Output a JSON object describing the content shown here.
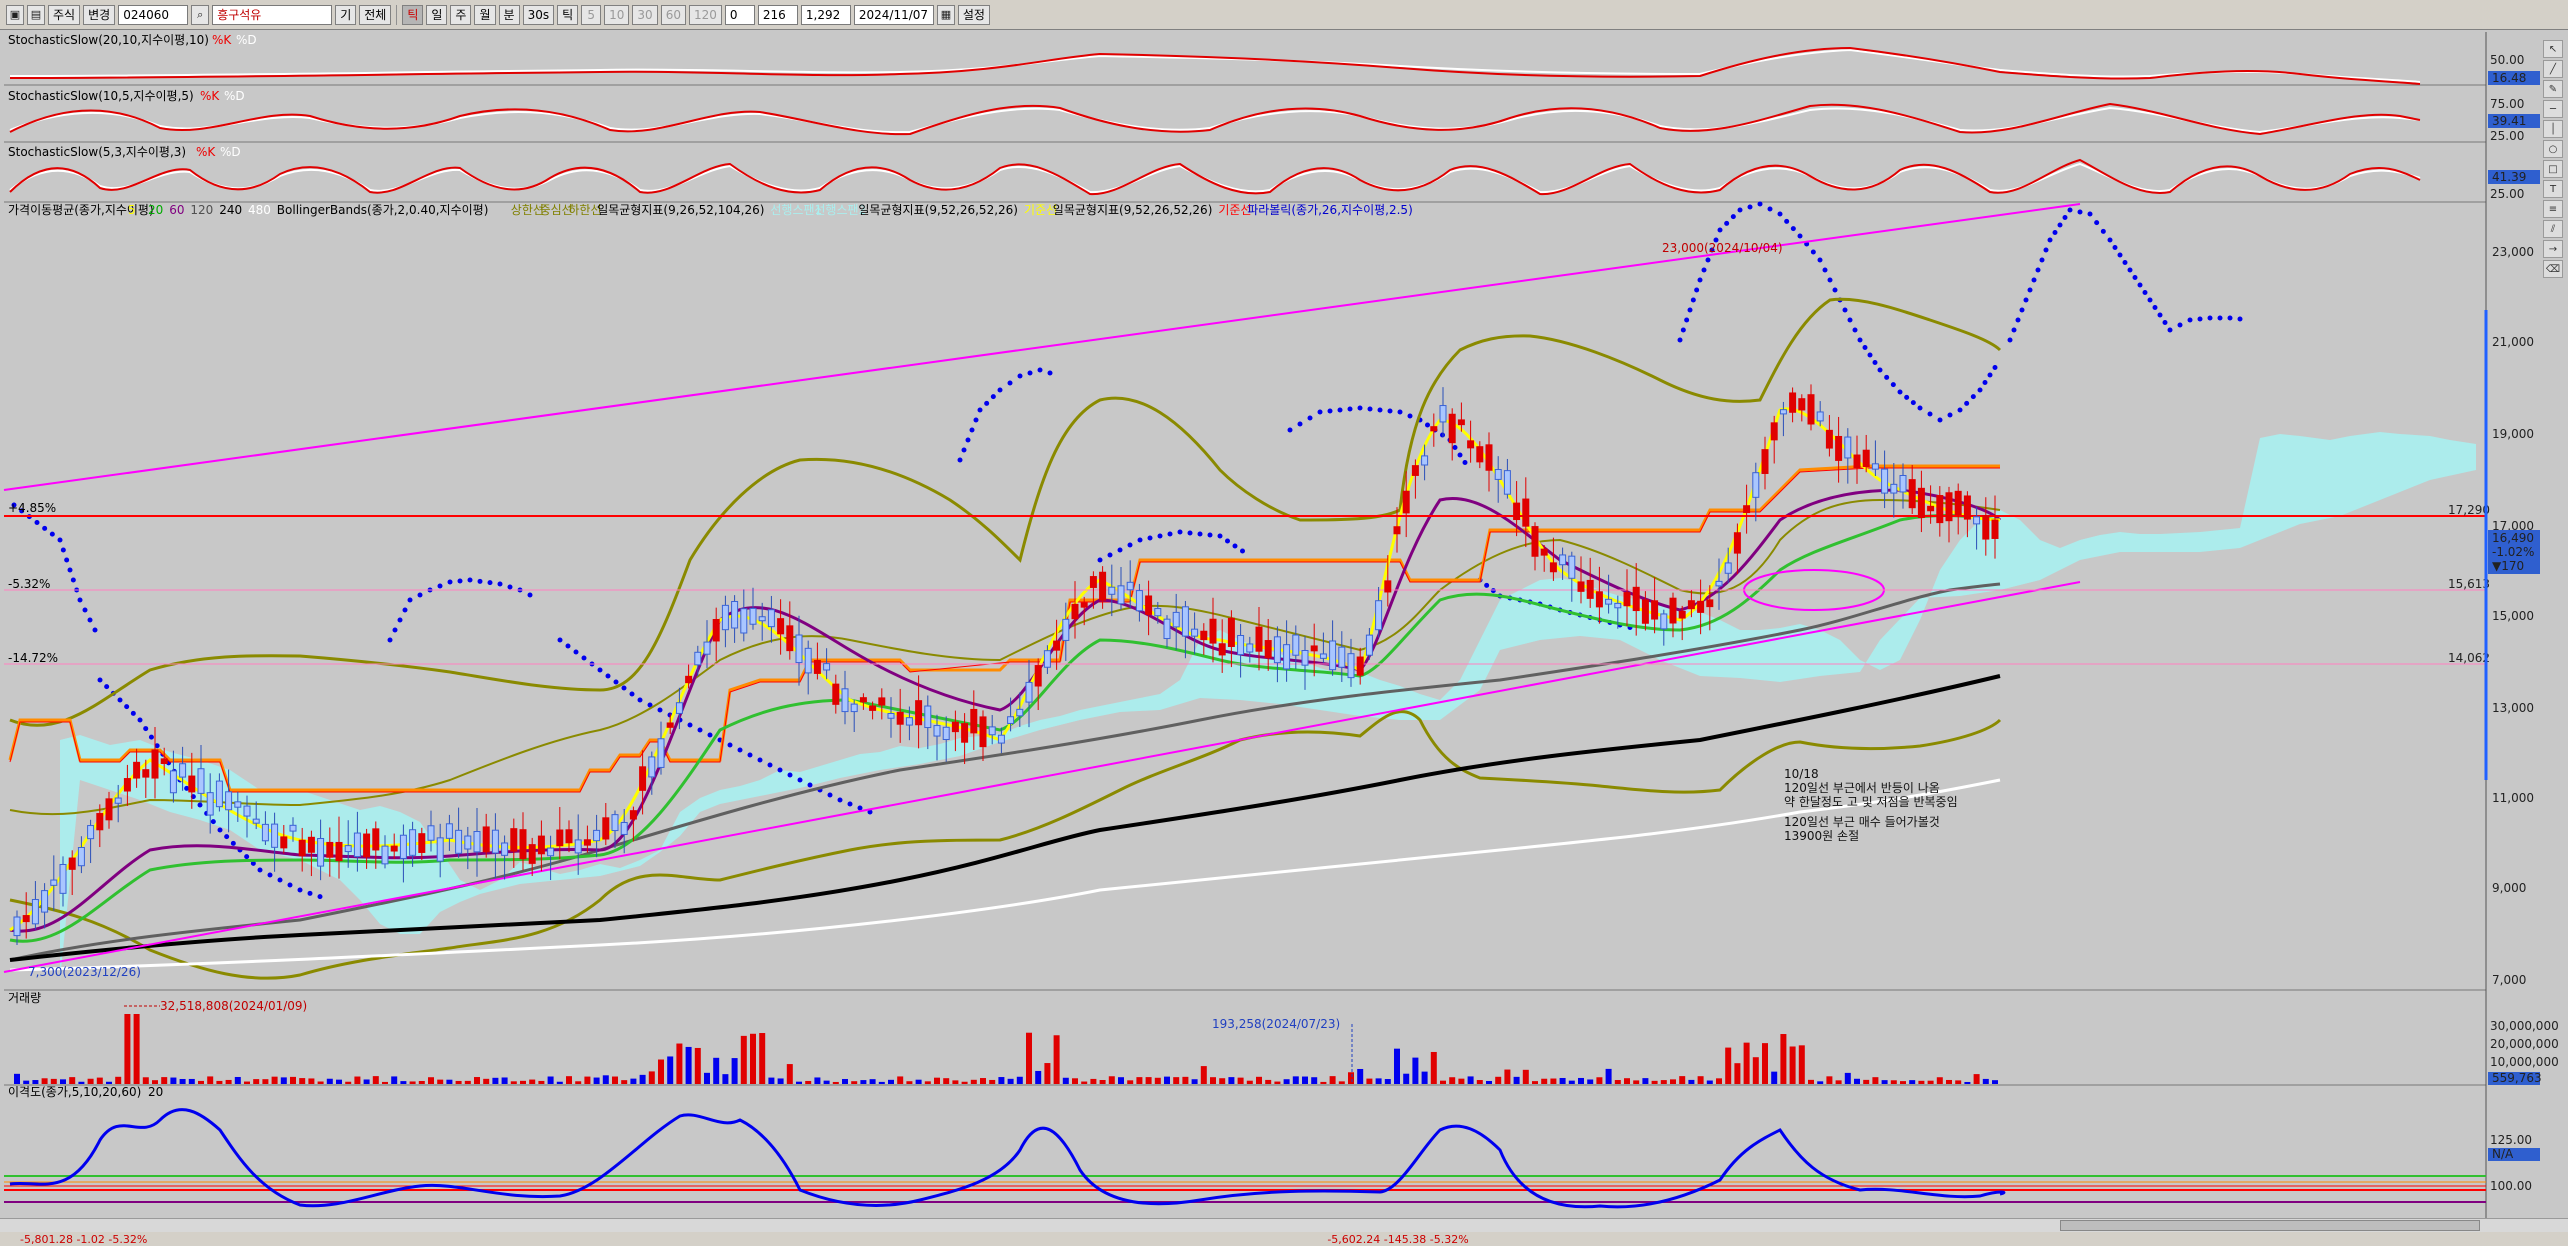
{
  "toolbar": {
    "market": "주식",
    "mode": "변경",
    "code": "024060",
    "name": "흥구석유",
    "period_labels": [
      "기",
      "전체"
    ],
    "timeframes": [
      "틱",
      "일",
      "주",
      "월",
      "분",
      "30s",
      "틱"
    ],
    "numbers": [
      "5",
      "10",
      "30",
      "60",
      "120"
    ],
    "zero": "0",
    "count": "216",
    "ratio": "1,292",
    "date": "2024/11/07",
    "settings": "설정"
  },
  "panes": {
    "stoch1": "StochasticSlow(20,10,지수이평,10)",
    "stoch2": "StochasticSlow(10,5,지수이평,5)",
    "stoch3": "StochasticSlow(5,3,지수이평,3)",
    "k": "%K",
    "d": "%D",
    "price_legend": [
      {
        "text": "가격이동평균(종가,지수이평)",
        "color": "#000000"
      },
      {
        "text": "5",
        "color": "#ffff00"
      },
      {
        "text": "20",
        "color": "#00aa00"
      },
      {
        "text": "60",
        "color": "#800080"
      },
      {
        "text": "120",
        "color": "#505050"
      },
      {
        "text": "240",
        "color": "#000000"
      },
      {
        "text": "480",
        "color": "#ffffff"
      },
      {
        "text": "BollingerBands(종가,2,0.40,지수이평)",
        "color": "#000000"
      },
      {
        "text": "상한선",
        "color": "#808000"
      },
      {
        "text": "중심선",
        "color": "#808000"
      },
      {
        "text": "하한선",
        "color": "#808000"
      },
      {
        "text": "일목균형지표(9,26,52,104,26)",
        "color": "#000000"
      },
      {
        "text": "선행스팬1",
        "color": "#aaeeee"
      },
      {
        "text": "선행스팬2",
        "color": "#aaeeee"
      },
      {
        "text": "일목균형지표(9,52,26,52,26)",
        "color": "#000000"
      },
      {
        "text": "기준선",
        "color": "#ffff00"
      },
      {
        "text": "일목균형지표(9,52,26,52,26)",
        "color": "#000000"
      },
      {
        "text": "기준선",
        "color": "#ff0000"
      },
      {
        "text": "파라볼릭(종가,26,지수이평,2.5)",
        "color": "#0000cc"
      }
    ],
    "volume": "거래량",
    "disparity": "이격도(종가,5,10,20,60)",
    "disparity_val": "20"
  },
  "price_axis": {
    "ticks": [
      "23,000",
      "21,000",
      "19,000",
      "17,000",
      "15,000",
      "13,000",
      "11,000",
      "9,000",
      "7,000"
    ],
    "highlight_current": "16,490",
    "highlight_change": "-1.02%",
    "highlight_diff": "▼170",
    "level_17290": "17,290",
    "level_15613": "15,613",
    "level_14062": "14,062"
  },
  "stoch_axis": {
    "s1_ticks": [
      "50.00"
    ],
    "s1_val": "16.48",
    "s2_ticks": [
      "75.00",
      "25.00"
    ],
    "s2_val": "39.41",
    "s3_ticks": [
      "25.00"
    ],
    "s3_val": "41.39"
  },
  "volume_axis": {
    "ticks": [
      "30,000,000",
      "20,000,000",
      "10,000,000"
    ],
    "val": "559,763"
  },
  "disp_axis": {
    "ticks": [
      "125.00",
      "100.00"
    ],
    "val": "N/A"
  },
  "annotations": {
    "pct_pos": "+4.85%",
    "pct_neg1": "-5.32%",
    "pct_neg2": "-14.72%",
    "high": "23,000(2024/10/04)",
    "low": "7,300(2023/12/26)",
    "vol_max": "32,518,808(2024/01/09)",
    "vol_mark": "193,258(2024/07/23)",
    "note_lines": [
      "10/18",
      "120일선 부근에서 반등이 나옴",
      "약 한달정도 고 및 저점을 반복중임",
      "",
      "120일선 부근 매수 들어가볼것",
      "13900원 손절"
    ]
  },
  "status": {
    "left": "-5,801.28   -1.02   -5.32%",
    "mid": "-5,602.24   -145.38   -5.32%"
  }
}
